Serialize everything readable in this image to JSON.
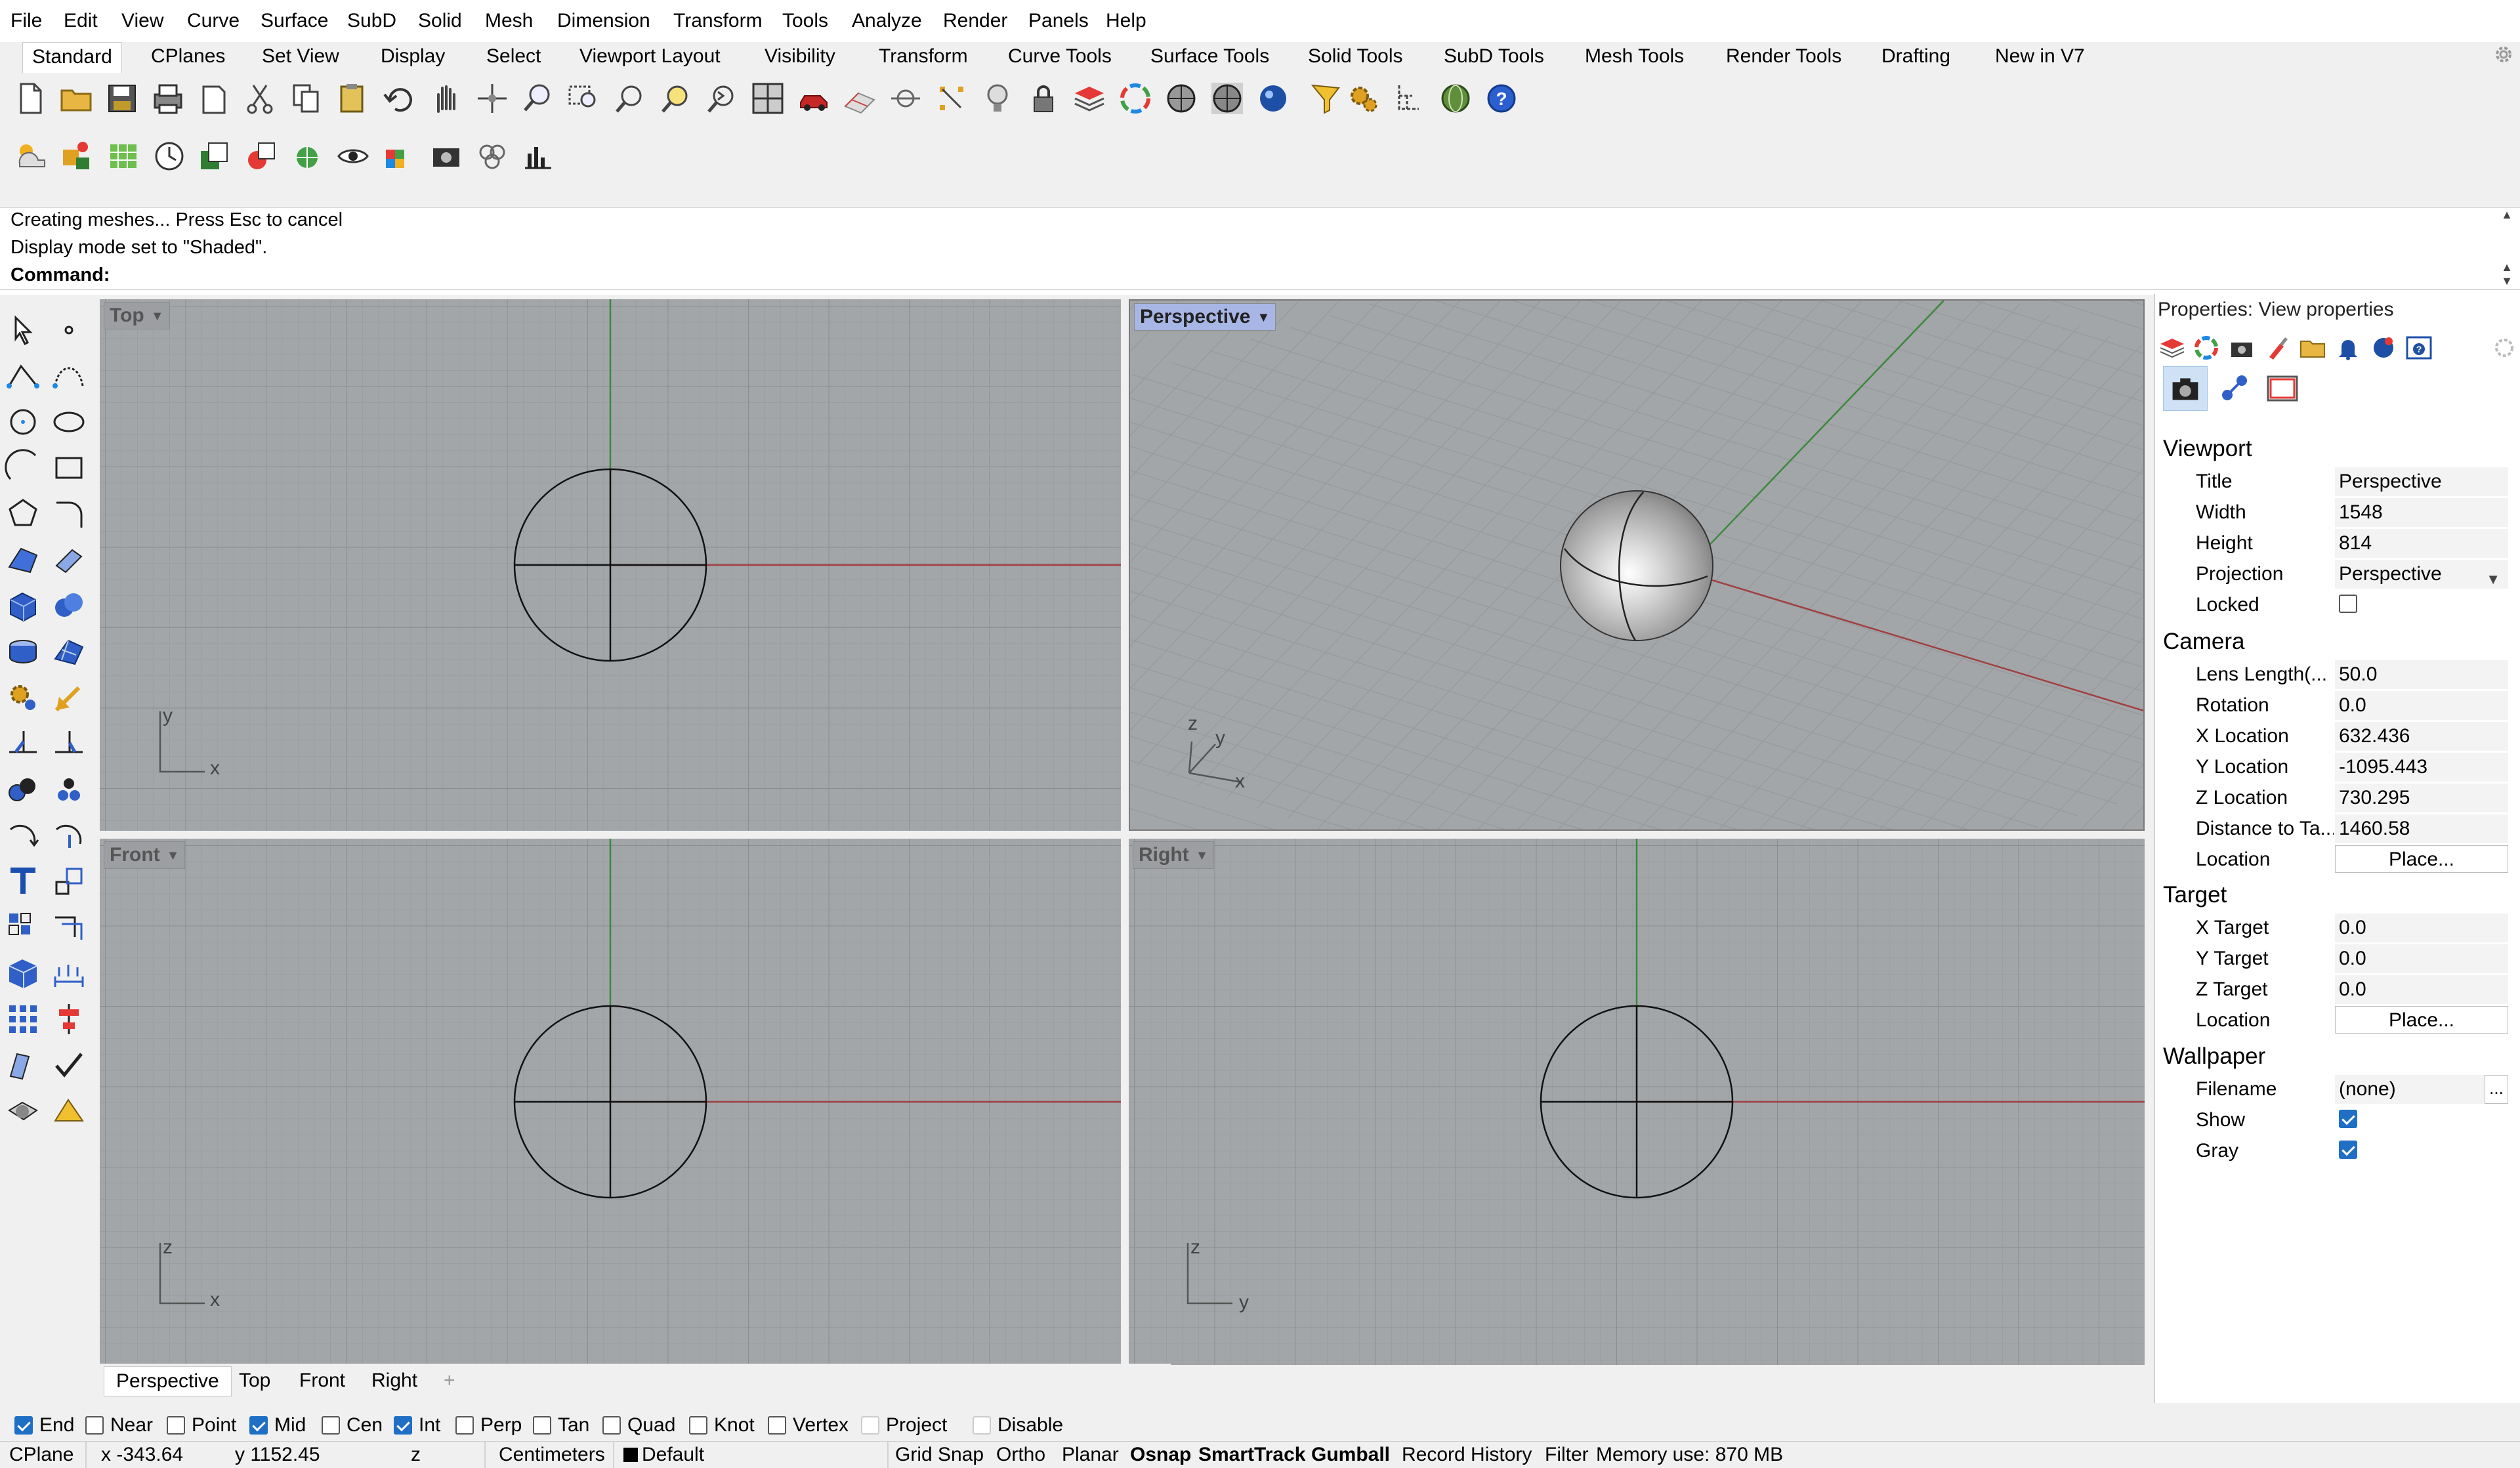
{
  "menu": [
    "File",
    "Edit",
    "View",
    "Curve",
    "Surface",
    "SubD",
    "Solid",
    "Mesh",
    "Dimension",
    "Transform",
    "Tools",
    "Analyze",
    "Render",
    "Panels",
    "Help"
  ],
  "toolbar_tabs": [
    "Standard",
    "CPlanes",
    "Set View",
    "Display",
    "Select",
    "Viewport Layout",
    "Visibility",
    "Transform",
    "Curve Tools",
    "Surface Tools",
    "Solid Tools",
    "SubD Tools",
    "Mesh Tools",
    "Render Tools",
    "Drafting",
    "New in V7"
  ],
  "active_toolbar_tab": "Standard",
  "command": {
    "history": [
      "Creating meshes... Press Esc to cancel",
      "Display mode set to \"Shaded\"."
    ],
    "prompt_label": "Command:",
    "value": ""
  },
  "viewports": {
    "top": {
      "label": "Top",
      "axis_a": "y",
      "axis_b": "x"
    },
    "perspective": {
      "label": "Perspective",
      "axis_z": "z",
      "axis_y": "y",
      "axis_x": "x"
    },
    "front": {
      "label": "Front",
      "axis_a": "z",
      "axis_b": "x"
    },
    "right": {
      "label": "Right",
      "axis_a": "z",
      "axis_b": "y"
    }
  },
  "viewport_tabs": [
    "Perspective",
    "Top",
    "Front",
    "Right"
  ],
  "viewport_tabs_add": "+",
  "osnaps": [
    {
      "label": "End",
      "checked": true
    },
    {
      "label": "Near",
      "checked": false
    },
    {
      "label": "Point",
      "checked": false
    },
    {
      "label": "Mid",
      "checked": true
    },
    {
      "label": "Cen",
      "checked": false
    },
    {
      "label": "Int",
      "checked": true
    },
    {
      "label": "Perp",
      "checked": false
    },
    {
      "label": "Tan",
      "checked": false
    },
    {
      "label": "Quad",
      "checked": false
    },
    {
      "label": "Knot",
      "checked": false
    },
    {
      "label": "Vertex",
      "checked": false
    },
    {
      "label": "Project",
      "checked": false
    },
    {
      "label": "Disable",
      "checked": false
    }
  ],
  "status": {
    "cplane": "CPlane",
    "x": "x -343.64",
    "y": "y 1152.45",
    "z": "z",
    "units": "Centimeters",
    "layer": "Default",
    "grid_snap": "Grid Snap",
    "ortho": "Ortho",
    "planar": "Planar",
    "osnap": "Osnap",
    "smarttrack": "SmartTrack",
    "gumball": "Gumball",
    "record_history": "Record History",
    "filter": "Filter",
    "memory": "Memory use: 870 MB"
  },
  "properties": {
    "title": "Properties: View properties",
    "sections": {
      "viewport": "Viewport",
      "camera": "Camera",
      "target": "Target",
      "wallpaper": "Wallpaper"
    },
    "viewport": {
      "title_label": "Title",
      "title": "Perspective",
      "width_label": "Width",
      "width": "1548",
      "height_label": "Height",
      "height": "814",
      "projection_label": "Projection",
      "projection": "Perspective",
      "locked_label": "Locked",
      "locked": false
    },
    "camera": {
      "lens_label": "Lens Length(...",
      "lens": "50.0",
      "rotation_label": "Rotation",
      "rotation": "0.0",
      "xloc_label": "X Location",
      "xloc": "632.436",
      "yloc_label": "Y Location",
      "yloc": "-1095.443",
      "zloc_label": "Z Location",
      "zloc": "730.295",
      "dist_label": "Distance to Ta...",
      "dist": "1460.58",
      "location_label": "Location",
      "place": "Place..."
    },
    "target": {
      "x_label": "X Target",
      "x": "0.0",
      "y_label": "Y Target",
      "y": "0.0",
      "z_label": "Z Target",
      "z": "0.0",
      "location_label": "Location",
      "place": "Place..."
    },
    "wallpaper": {
      "filename_label": "Filename",
      "filename": "(none)",
      "browse": "...",
      "show_label": "Show",
      "show": true,
      "gray_label": "Gray",
      "gray": true
    }
  }
}
